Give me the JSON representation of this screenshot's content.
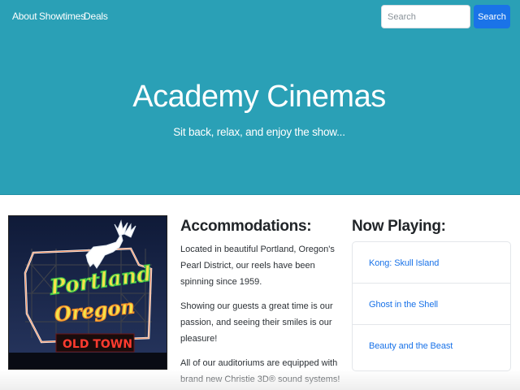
{
  "nav": {
    "links": [
      "About",
      "Showtimes",
      "Deals"
    ],
    "search_placeholder": "Search",
    "search_button": "Search"
  },
  "hero": {
    "title": "Academy Cinemas",
    "subtitle": "Sit back, relax, and enjoy the show..."
  },
  "photo": {
    "sign_line1": "Portland",
    "sign_line2": "Oregon",
    "sign_line3": "OLD TOWN"
  },
  "accommodations": {
    "heading": "Accommodations:",
    "paragraphs": [
      "Located in beautiful Portland, Oregon's Pearl District, our reels have been spinning since 1959.",
      "Showing our guests a great time is our passion, and seeing their smiles is our pleasure!",
      "All of our auditoriums are equipped with brand new Christie 3D® sound systems!"
    ]
  },
  "now_playing": {
    "heading": "Now Playing:",
    "movies": [
      "Kong: Skull Island",
      "Ghost in the Shell",
      "Beauty and the Beast"
    ]
  },
  "colors": {
    "hero_bg": "#2aa0b6",
    "link": "#1a73e8",
    "button": "#1a73e8"
  }
}
